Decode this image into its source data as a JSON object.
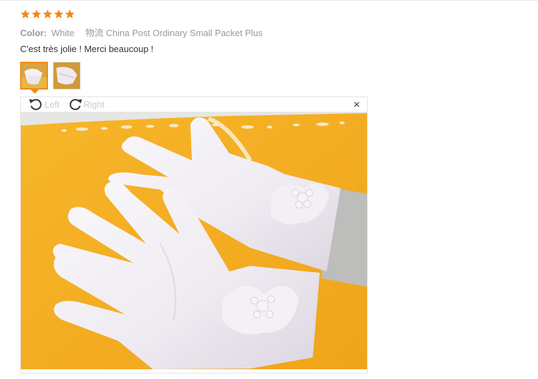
{
  "review": {
    "rating": 5,
    "rating_color": "#f08a1a",
    "color_label": "Color:",
    "color_value": "White",
    "shipping": "物流 China Post Ordinary Small Packet Plus",
    "text": "C'est très jolie ! Merci beaucoup !"
  },
  "thumbnails": [
    {
      "name": "photo-1",
      "selected": true
    },
    {
      "name": "photo-2",
      "selected": false
    }
  ],
  "viewer": {
    "rotate_left_label": "Left",
    "rotate_right_label": "Right",
    "rotate_left_icon": "rotate-left-icon",
    "rotate_right_icon": "rotate-right-icon",
    "close_glyph": "×",
    "close_icon": "close-icon"
  },
  "colors": {
    "accent": "#f08a1a",
    "photo_background": "#f2aa1e",
    "glove": "#f1eef3"
  }
}
